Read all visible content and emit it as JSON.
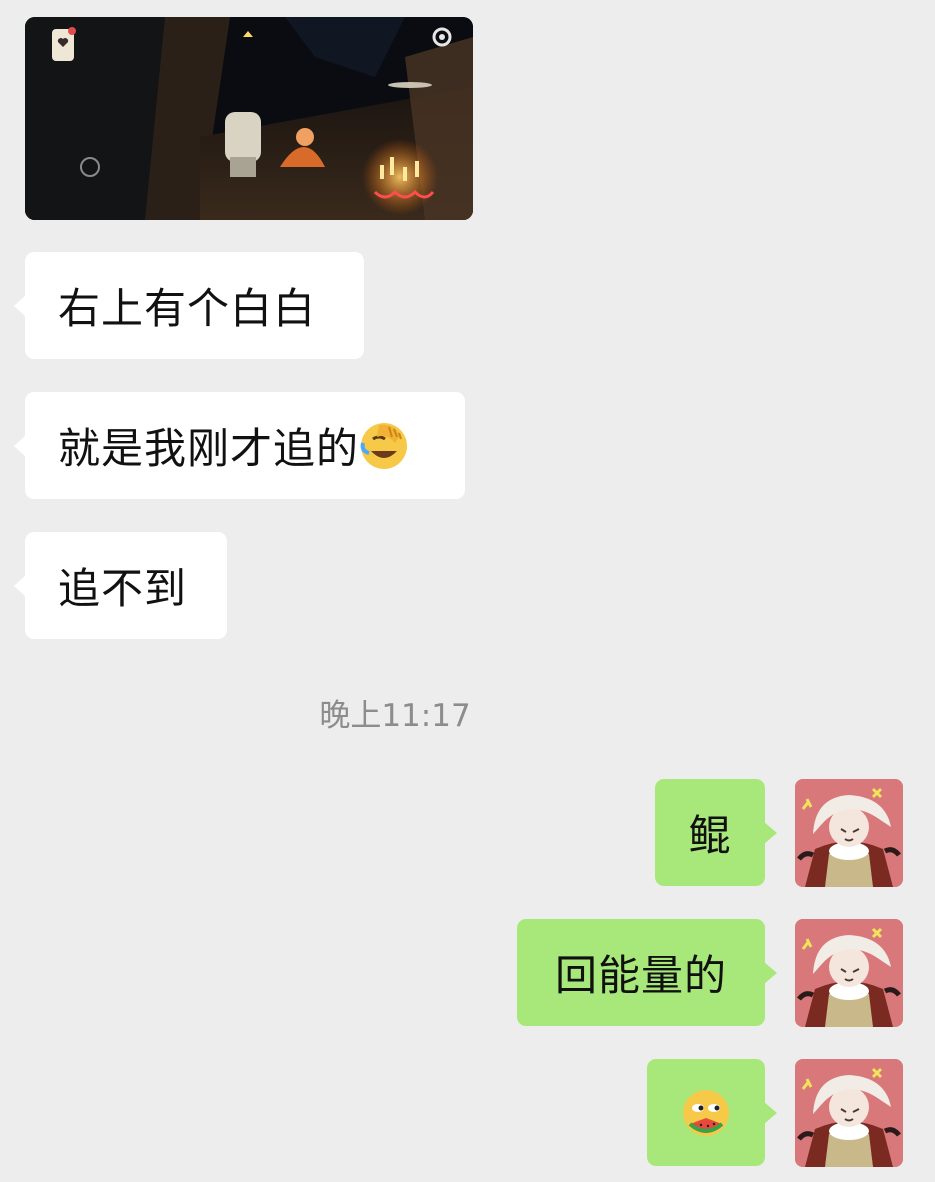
{
  "messages": {
    "incoming": [
      {
        "text": "右上有个白白"
      },
      {
        "text": "就是我刚才追的",
        "emoji": "facepalm-laugh-emoji"
      },
      {
        "text": "追不到"
      }
    ],
    "timestamp": "晚上11:17",
    "outgoing": [
      {
        "text": "鲲"
      },
      {
        "text": "回能量的"
      },
      {
        "text": "",
        "emoji": "eating-watermelon-emoji"
      }
    ]
  },
  "colors": {
    "background": "#ededed",
    "incoming_bubble": "#ffffff",
    "outgoing_bubble": "#a8e87a",
    "timestamp_text": "#8c8c8c"
  }
}
